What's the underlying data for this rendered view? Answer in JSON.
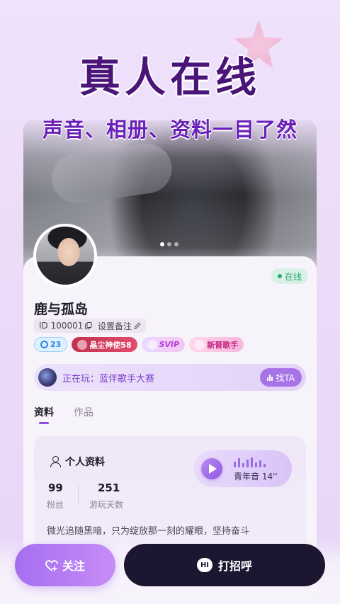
{
  "promo": {
    "headline": "真人在线",
    "subline": "声音、相册、资料一目了然"
  },
  "carousel": {
    "count": 3,
    "active_index": 0
  },
  "profile": {
    "status": "在线",
    "name": "鹿与孤岛",
    "id": "ID 100001",
    "remark_label": "设置备注",
    "badges": {
      "level": "23",
      "crystal": "晶尘神使58",
      "svip": "SVIP",
      "singer": "新晋歌手"
    },
    "playing": {
      "text": "正在玩：蓝伴歌手大赛",
      "find_label": "找TA"
    }
  },
  "tabs": [
    {
      "label": "资料",
      "active": true
    },
    {
      "label": "作品",
      "active": false
    }
  ],
  "info": {
    "title": "个人资料",
    "voice": {
      "label": "青年音 14''"
    },
    "stats": [
      {
        "value": "99",
        "label": "粉丝"
      },
      {
        "value": "251",
        "label": "游玩天数"
      }
    ],
    "bio": "微光追随黑暗，只为绽放那一刻的耀眼，坚持奋斗"
  },
  "actions": {
    "follow_label": "关注",
    "greet_label": "打招呼",
    "greet_icon_text": "HI"
  },
  "colors": {
    "accent": "#8a4fe0",
    "online": "#30a874",
    "dark_button": "#1c1631"
  }
}
